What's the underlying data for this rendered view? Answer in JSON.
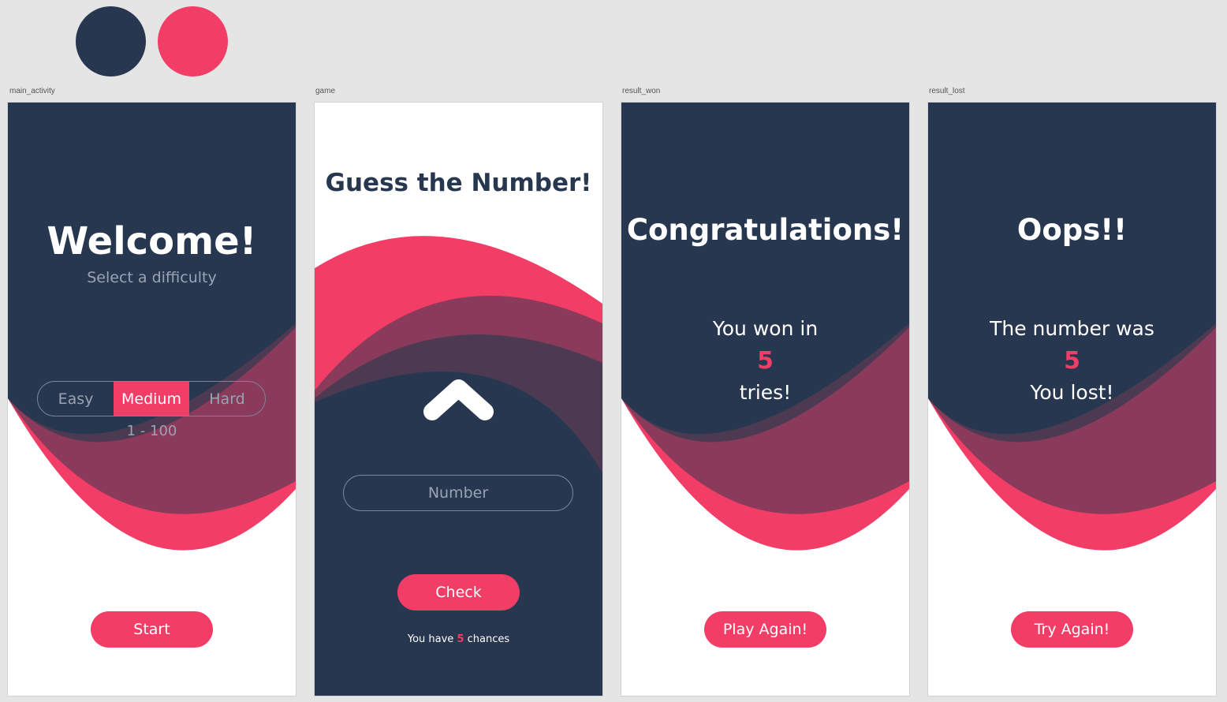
{
  "palette": {
    "navy": "#283750",
    "pink": "#f23d66"
  },
  "artboards": {
    "main_activity": "main_activity",
    "game": "game",
    "result_won": "result_won",
    "result_lost": "result_lost"
  },
  "main_activity": {
    "title": "Welcome!",
    "subtitle": "Select a difficulty",
    "difficulty_options": [
      "Easy",
      "Medium",
      "Hard"
    ],
    "selected_difficulty": "Medium",
    "range": "1 - 100",
    "start_label": "Start"
  },
  "game": {
    "title": "Guess the Number!",
    "hint_icon": "chevron-up-icon",
    "input_placeholder": "Number",
    "check_label": "Check",
    "chances_prefix": "You have",
    "chances_count": "5",
    "chances_suffix": "chances"
  },
  "result_won": {
    "title": "Congratulations!",
    "line1": "You won in",
    "count": "5",
    "line2": "tries!",
    "button_label": "Play Again!"
  },
  "result_lost": {
    "title": "Oops!!",
    "line1": "The number was",
    "count": "5",
    "line2": "You lost!",
    "button_label": "Try Again!"
  }
}
